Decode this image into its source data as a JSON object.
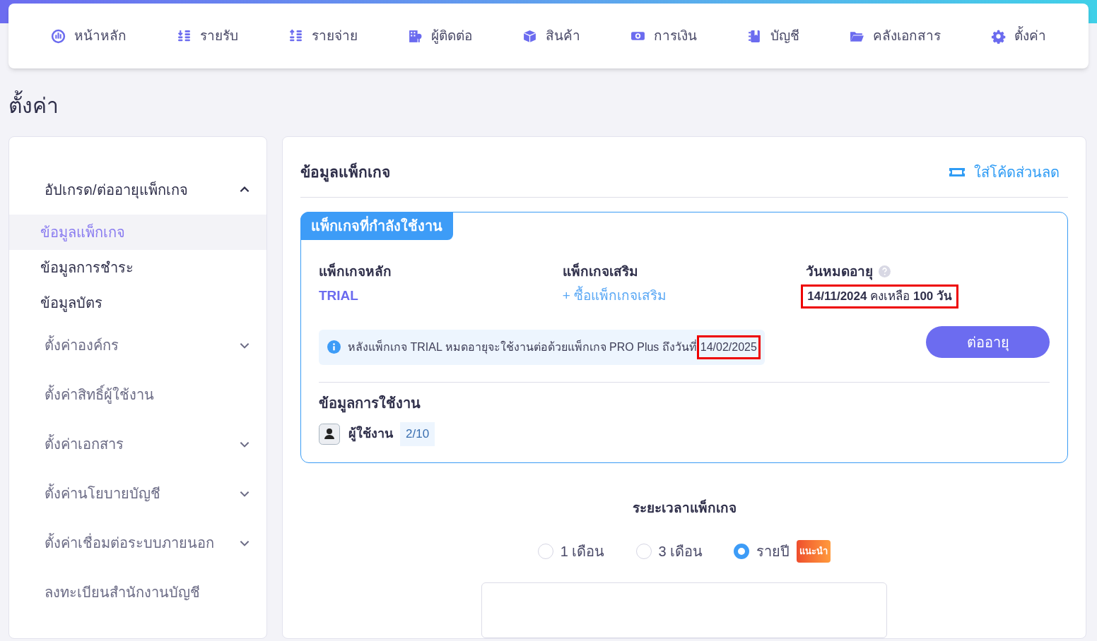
{
  "nav": [
    {
      "label": "หน้าหลัก"
    },
    {
      "label": "รายรับ"
    },
    {
      "label": "รายจ่าย"
    },
    {
      "label": "ผู้ติดต่อ"
    },
    {
      "label": "สินค้า"
    },
    {
      "label": "การเงิน"
    },
    {
      "label": "บัญชี"
    },
    {
      "label": "คลังเอกสาร"
    },
    {
      "label": "ตั้งค่า"
    }
  ],
  "page_title": "ตั้งค่า",
  "sidebar": {
    "items": [
      {
        "label": "อัปเกรด/ต่ออายุแพ็กเกจ",
        "expanded": true,
        "children": [
          {
            "label": "ข้อมูลแพ็กเกจ",
            "selected": true
          },
          {
            "label": "ข้อมูลการชำระ",
            "selected": false
          },
          {
            "label": "ข้อมูลบัตร",
            "selected": false
          }
        ]
      },
      {
        "label": "ตั้งค่าองค์กร",
        "expanded": false
      },
      {
        "label": "ตั้งค่าสิทธิ์ผู้ใช้งาน"
      },
      {
        "label": "ตั้งค่าเอกสาร",
        "expanded": false
      },
      {
        "label": "ตั้งค่านโยบายบัญชี",
        "expanded": false
      },
      {
        "label": "ตั้งค่าเชื่อมต่อระบบภายนอก",
        "expanded": false
      },
      {
        "label": "ลงทะเบียนสำนักงานบัญชี"
      }
    ]
  },
  "panel": {
    "title": "ข้อมูลแพ็กเกจ",
    "coupon_link": "ใส่โค้ดส่วนลด",
    "current": {
      "tab": "แพ็กเกจที่กำลังใช้งาน",
      "main_label": "แพ็กเกจหลัก",
      "main_value": "TRIAL",
      "addon_label": "แพ็กเกจเสริม",
      "addon_link": "+ ซื้อแพ็กเกจเสริม",
      "expiry_label": "วันหมดอายุ",
      "expiry_value": "**14/11/2024** คงเหลือ **100 วัน**",
      "expiry_highlighted": true,
      "notice": "หลังแพ็กเกจ TRIAL หมดอายุจะใช้งานต่อด้วยแพ็กเกจ PRO Plus ถึงวันที่",
      "notice_date": "14/02/2025",
      "notice_date_highlighted": true,
      "renew_button": "ต่ออายุ",
      "usage_title": "ข้อมูลการใช้งาน",
      "users_label": "ผู้ใช้งาน",
      "users_value": "2/10"
    },
    "duration_title": "ระยะเวลาแพ็กเกจ",
    "durations": [
      {
        "label": "1 เดือน",
        "selected": false
      },
      {
        "label": "3 เดือน",
        "selected": false
      },
      {
        "label": "รายปี",
        "selected": true,
        "badge": "แนะนำ"
      }
    ]
  }
}
